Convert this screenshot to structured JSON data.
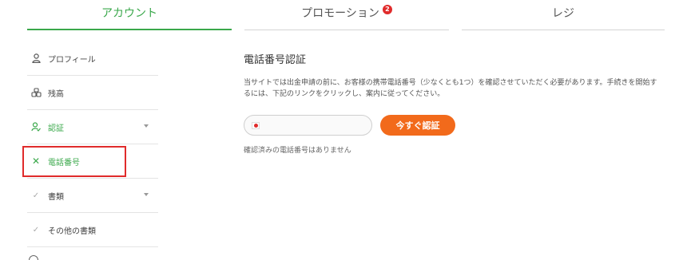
{
  "tabs": [
    {
      "label": "アカウント",
      "active": true
    },
    {
      "label": "プロモーション",
      "badge": "2",
      "active": false
    },
    {
      "label": "レジ",
      "active": false
    }
  ],
  "sidebar": {
    "items": [
      {
        "label": "プロフィール",
        "icon": "user-icon"
      },
      {
        "label": "残高",
        "icon": "coins-icon"
      },
      {
        "label": "認証",
        "icon": "verify-icon"
      },
      {
        "label": "電話番号",
        "icon": "cross-icon"
      },
      {
        "label": "書類",
        "icon": "check-icon"
      },
      {
        "label": "その他の書類",
        "icon": "check-icon"
      }
    ]
  },
  "main": {
    "title": "電話番号認証",
    "description": "当サイトでは出金申請の前に、お客様の携帯電話番号（少なくとも1つ）を確認させていただく必要があります。手続きを開始するには、下記のリンクをクリックし、案内に従ってください。",
    "phone_placeholder": "",
    "verify_button": "今すぐ認証",
    "note": "確認済みの電話番号はありません"
  },
  "colors": {
    "accent_green": "#3aa84b",
    "button_orange": "#f26a1b",
    "alert_red": "#e02b2b"
  }
}
